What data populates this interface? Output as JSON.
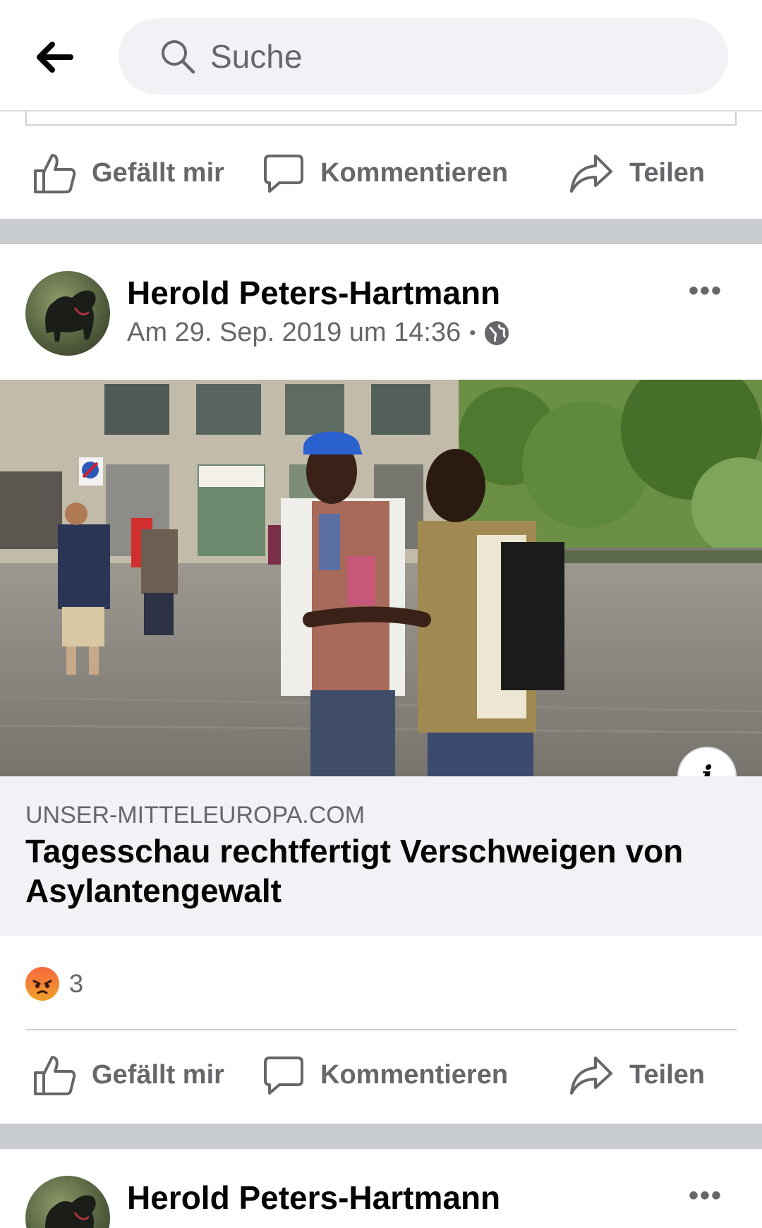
{
  "search": {
    "placeholder": "Suche"
  },
  "actions": {
    "like": "Gefällt mir",
    "comment": "Kommentieren",
    "share": "Teilen"
  },
  "posts": [
    {
      "author": "Herold Peters-Hartmann",
      "timestamp": "Am 29. Sep. 2019 um 14:36",
      "privacy_separator": "•",
      "privacy_icon": "globe-icon",
      "more_label": "•••",
      "link": {
        "domain": "UNSER-MITTELEUROPA.COM",
        "title": "Tagesschau rechtfertigt Verschweigen von Asylantengewalt",
        "info_label": "i"
      },
      "reactions": {
        "icon": "angry-reaction-icon",
        "count": "3"
      }
    },
    {
      "author": "Herold Peters-Hartmann",
      "more_label": "•••"
    }
  ]
}
